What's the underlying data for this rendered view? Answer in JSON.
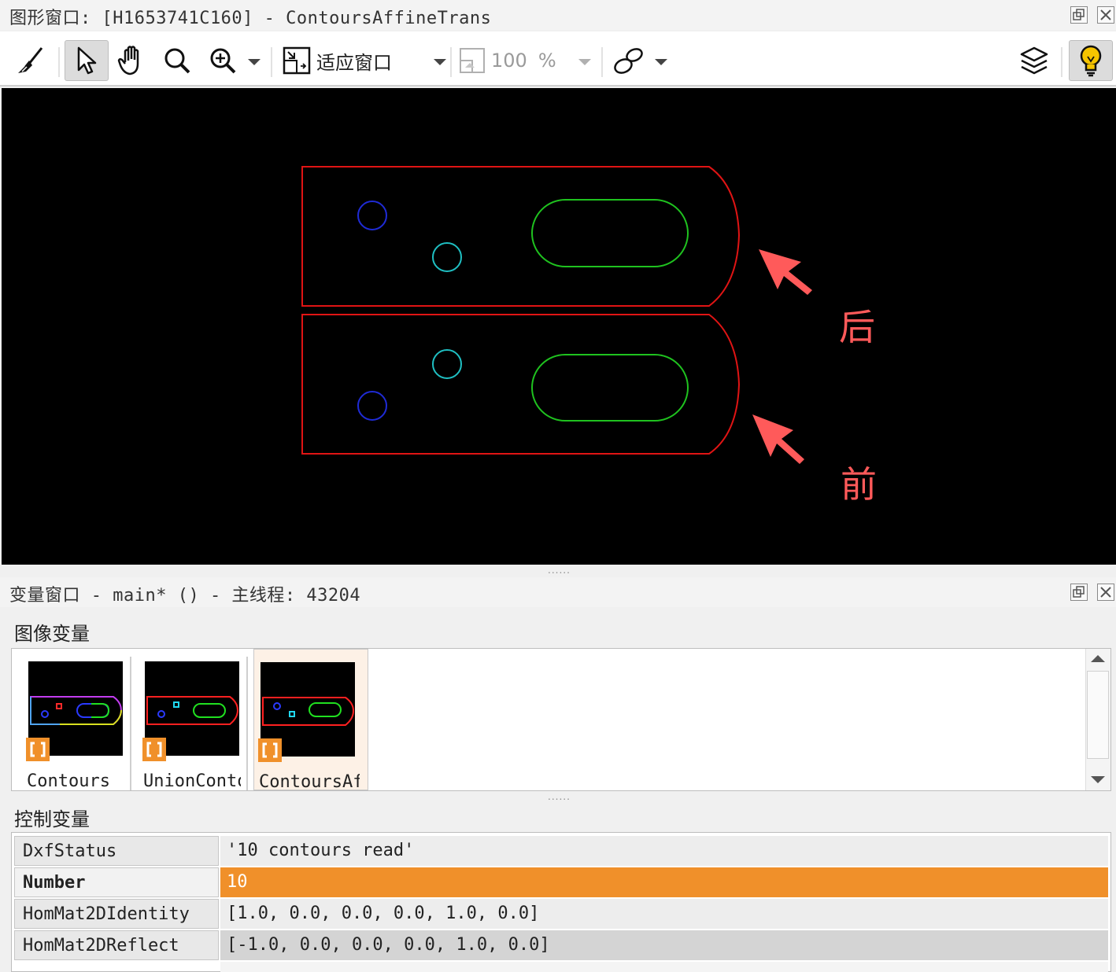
{
  "graphics_window": {
    "title": "图形窗口: [H1653741C160] - ContoursAffineTrans",
    "toolbar": {
      "clear_icon": "broom-icon",
      "select_icon": "pointer-icon",
      "pan_icon": "hand-icon",
      "zoom_icon": "magnifier-icon",
      "zoomin_icon": "zoom-in-icon",
      "fit_label": "适应窗口",
      "zoom_value": "100",
      "zoom_unit": "%",
      "shape_icon": "lasso-icon",
      "layers_icon": "layers-icon",
      "bulb_icon": "lightbulb-icon"
    },
    "annotations": {
      "back_label": "后",
      "front_label": "前",
      "arrow_color": "#ff5a5a"
    },
    "contour_colors": {
      "outline": "#e01414",
      "slot": "#1fc21f",
      "hole_blue": "#1f2bd6",
      "hole_cyan": "#1fbfc2"
    }
  },
  "variable_window": {
    "title": "变量窗口 - main* () - 主线程: 43204",
    "image_section_label": "图像变量",
    "image_vars": [
      {
        "label": "Contours",
        "tag_icon": "object-tag-icon"
      },
      {
        "label": "UnionContours",
        "tag_icon": "object-tag-icon"
      },
      {
        "label": "ContoursAffineTrans",
        "tag_icon": "object-tag-icon"
      }
    ],
    "control_section_label": "控制变量",
    "control_vars": [
      {
        "name": "DxfStatus",
        "value": "'10 contours read'"
      },
      {
        "name": "Number",
        "value": "10"
      },
      {
        "name": "HomMat2DIdentity",
        "value": "[1.0, 0.0, 0.0, 0.0, 1.0, 0.0]"
      },
      {
        "name": "HomMat2DReflect",
        "value": "[-1.0, 0.0, 0.0, 0.0, 1.0, 0.0]"
      }
    ],
    "highlight_color": "#f0902a"
  }
}
